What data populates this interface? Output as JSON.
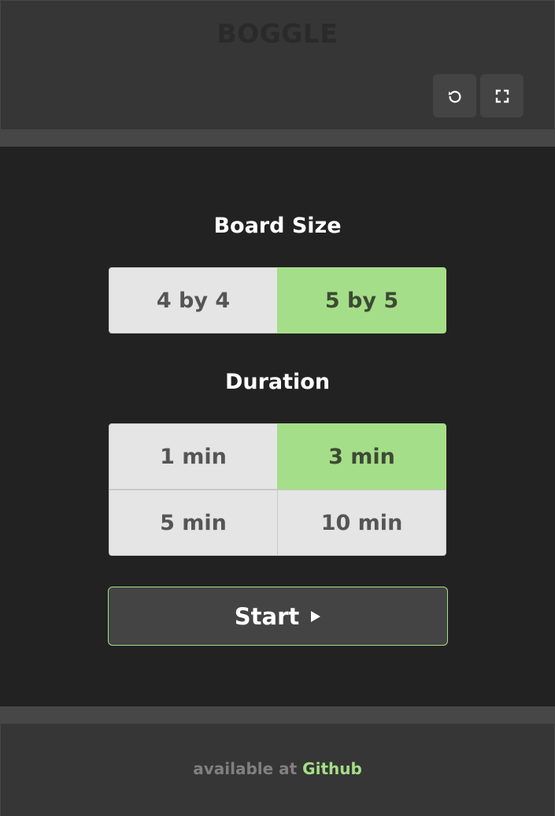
{
  "header": {
    "title": "BOGGLE",
    "buttons": [
      {
        "name": "reset",
        "icon": "reset-icon"
      },
      {
        "name": "fullscreen",
        "icon": "fullscreen-icon"
      }
    ]
  },
  "board_size": {
    "label": "Board Size",
    "options": [
      "4 by 4",
      "5 by 5"
    ],
    "selected": "5 by 5"
  },
  "duration": {
    "label": "Duration",
    "options": [
      "1 min",
      "3 min",
      "5 min",
      "10 min"
    ],
    "selected": "3 min"
  },
  "start": {
    "label": "Start",
    "icon": "play-icon"
  },
  "footer": {
    "prefix": "available at ",
    "link_text": "Github"
  },
  "colors": {
    "accent": "#a5de88",
    "background": "#222222",
    "panel": "#363636"
  }
}
